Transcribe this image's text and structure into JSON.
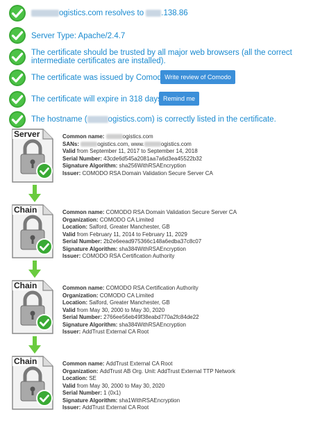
{
  "checks": {
    "resolves": {
      "pre": "",
      "domain_suffix": "ogistics.com",
      "mid": " resolves to ",
      "ip_suffix": ".138.86"
    },
    "server_type": "Server Type: Apache/2.4.7",
    "trusted": "The certificate should be trusted by all major web browsers (all the correct intermediate certificates are installed).",
    "issued_by": "The certificate was issued by Comodo.",
    "issued_button": "Write review of Comodo",
    "expire": "The certificate will expire in 318 days.",
    "expire_button": "Remind me",
    "hostname": {
      "pre": "The hostname (",
      "domain_suffix": "ogistics.com",
      "post": ") is correctly listed in the certificate."
    }
  },
  "certs": [
    {
      "label": "Server",
      "lines": [
        {
          "k": "Common name: ",
          "v": "ogistics.com",
          "blur": true
        },
        {
          "k": "SANs: ",
          "v": "ogistics.com, www.",
          "blur": true,
          "tail": "ogistics.com"
        },
        {
          "k": "Valid",
          "v": " from September 11, 2017 to September 14, 2018"
        },
        {
          "k": "Serial Number: ",
          "v": "43cde6d545a2081aa7a6d3ea45522b32"
        },
        {
          "k": "Signature Algorithm: ",
          "v": "sha256WithRSAEncryption"
        },
        {
          "k": "Issuer: ",
          "v": "COMODO RSA Domain Validation Secure Server CA"
        }
      ]
    },
    {
      "label": "Chain",
      "lines": [
        {
          "k": "Common name: ",
          "v": "COMODO RSA Domain Validation Secure Server CA"
        },
        {
          "k": "Organization: ",
          "v": "COMODO CA Limited"
        },
        {
          "k": "Location: ",
          "v": "Salford, Greater Manchester, GB"
        },
        {
          "k": "Valid",
          "v": " from February 11, 2014 to February 11, 2029"
        },
        {
          "k": "Serial Number: ",
          "v": "2b2e6eead975366c148a6edba37c8c07"
        },
        {
          "k": "Signature Algorithm: ",
          "v": "sha384WithRSAEncryption"
        },
        {
          "k": "Issuer: ",
          "v": "COMODO RSA Certification Authority"
        }
      ]
    },
    {
      "label": "Chain",
      "lines": [
        {
          "k": "Common name: ",
          "v": "COMODO RSA Certification Authority"
        },
        {
          "k": "Organization: ",
          "v": "COMODO CA Limited"
        },
        {
          "k": "Location: ",
          "v": "Salford, Greater Manchester, GB"
        },
        {
          "k": "Valid",
          "v": " from May 30, 2000 to May 30, 2020"
        },
        {
          "k": "Serial Number: ",
          "v": "2766ee56eb49f38eabd770a2fc84de22"
        },
        {
          "k": "Signature Algorithm: ",
          "v": "sha384WithRSAEncryption"
        },
        {
          "k": "Issuer: ",
          "v": "AddTrust External CA Root"
        }
      ]
    },
    {
      "label": "Chain",
      "lines": [
        {
          "k": "Common name: ",
          "v": "AddTrust External CA Root"
        },
        {
          "k": "Organization: ",
          "v": "AddTrust AB Org. Unit: AddTrust External TTP Network"
        },
        {
          "k": "Location: ",
          "v": "SE"
        },
        {
          "k": "Valid",
          "v": " from May 30, 2000 to May 30, 2020"
        },
        {
          "k": "Serial Number: ",
          "v": "1 (0x1)"
        },
        {
          "k": "Signature Algorithm: ",
          "v": "sha1WithRSAEncryption"
        },
        {
          "k": "Issuer: ",
          "v": "AddTrust External CA Root"
        }
      ]
    }
  ],
  "colors": {
    "accent": "#1a8ad0",
    "check_green": "#3aaa35",
    "button_blue": "#3b8fd9",
    "arrow_green": "#6acb3f"
  },
  "icons": [
    "check-icon",
    "certificate-lock-icon",
    "down-arrow-icon"
  ]
}
